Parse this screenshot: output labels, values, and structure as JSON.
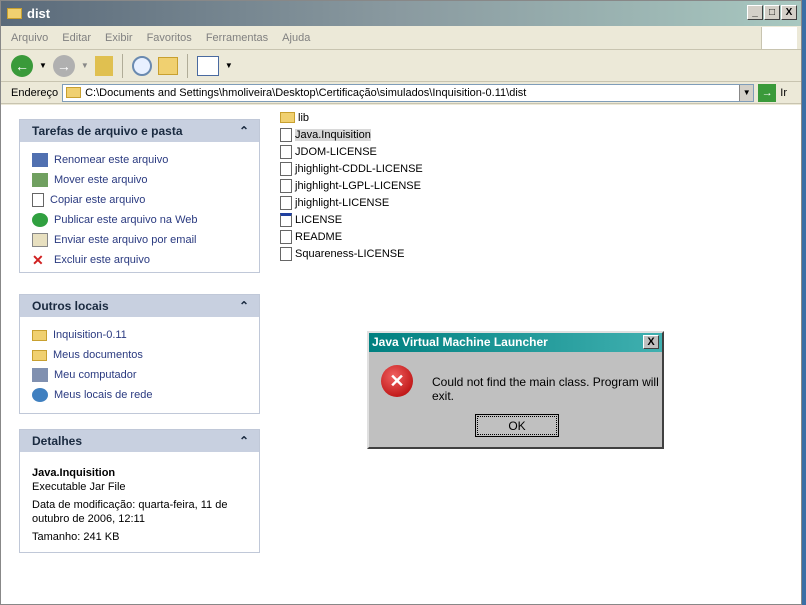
{
  "window": {
    "title": "dist",
    "buttons": [
      "_",
      "□",
      "X"
    ]
  },
  "menu": [
    "Arquivo",
    "Editar",
    "Exibir",
    "Favoritos",
    "Ferramentas",
    "Ajuda"
  ],
  "address": {
    "label": "Endereço",
    "path": "C:\\Documents and Settings\\hmoliveira\\Desktop\\Certificação\\simulados\\Inquisition-0.11\\dist",
    "go": "Ir"
  },
  "tasks": {
    "title": "Tarefas de arquivo e pasta",
    "items": [
      "Renomear este arquivo",
      "Mover este arquivo",
      "Copiar este arquivo",
      "Publicar este arquivo na Web",
      "Enviar este arquivo por email",
      "Excluir este arquivo"
    ]
  },
  "places": {
    "title": "Outros locais",
    "items": [
      "Inquisition-0.11",
      "Meus documentos",
      "Meu computador",
      "Meus locais de rede"
    ]
  },
  "details": {
    "title": "Detalhes",
    "name": "Java.Inquisition",
    "type": "Executable Jar File",
    "modified": "Data de modificação: quarta-feira, 11 de outubro de 2006, 12:11",
    "size": "Tamanho: 241 KB"
  },
  "files": [
    "lib",
    "Java.Inquisition",
    "JDOM-LICENSE",
    "jhighlight-CDDL-LICENSE",
    "jhighlight-LGPL-LICENSE",
    "jhighlight-LICENSE",
    "LICENSE",
    "README",
    "Squareness-LICENSE"
  ],
  "dialog": {
    "title": "Java Virtual Machine Launcher",
    "message": "Could not find the main class.  Program will exit.",
    "ok": "OK",
    "close": "X"
  }
}
